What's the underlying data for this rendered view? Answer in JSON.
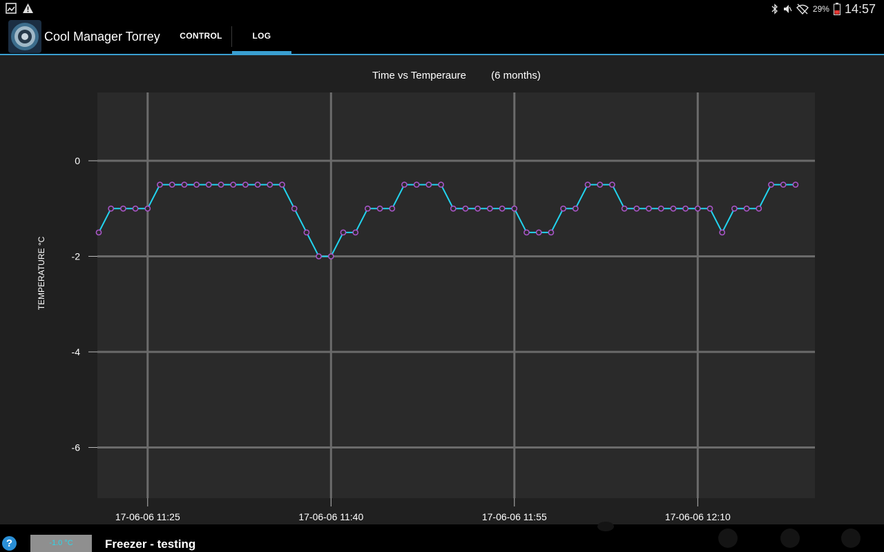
{
  "status_bar": {
    "left_icons": [
      "gallery-icon",
      "warning-icon"
    ],
    "right_icons": [
      "bluetooth-icon",
      "mute-icon",
      "wifi-off-icon",
      "battery-icon"
    ],
    "battery_percent": "29%",
    "time": "14:57"
  },
  "action_bar": {
    "app_icon": "cool-manager-logo",
    "title": "Cool Manager Torrey",
    "tabs": [
      {
        "label": "CONTROL",
        "selected": false
      },
      {
        "label": "LOG",
        "selected": true
      }
    ],
    "accent_color": "#3a9fd1"
  },
  "chart_data": {
    "type": "line",
    "title": "Time vs Temperaure",
    "subtitle": "(6 months)",
    "ylabel": "TEMPERATURE °C",
    "xlabel": "",
    "ylim": [
      -7,
      1.5
    ],
    "y_ticks": [
      {
        "value": 0,
        "label": "0"
      },
      {
        "value": -2,
        "label": "-2"
      },
      {
        "value": -4,
        "label": "-4"
      },
      {
        "value": -6,
        "label": "-6"
      }
    ],
    "x_ticks": [
      {
        "index": 4,
        "label": "17-06-06 11:25"
      },
      {
        "index": 19,
        "label": "17-06-06 11:40"
      },
      {
        "index": 34,
        "label": "17-06-06 11:55"
      },
      {
        "index": 49,
        "label": "17-06-06 12:10"
      }
    ],
    "grid": true,
    "line_color": "#22d3ee",
    "marker_color": "#a855c7",
    "series": [
      {
        "values": [
          -1.5,
          -1,
          -1,
          -1,
          -1,
          -0.5,
          -0.5,
          -0.5,
          -0.5,
          -0.5,
          -0.5,
          -0.5,
          -0.5,
          -0.5,
          -0.5,
          -0.5,
          -1,
          -1.5,
          -2,
          -2,
          -1.5,
          -1.5,
          -1,
          -1,
          -1,
          -0.5,
          -0.5,
          -0.5,
          -0.5,
          -1,
          -1,
          -1,
          -1,
          -1,
          -1,
          -1.5,
          -1.5,
          -1.5,
          -1,
          -1,
          -0.5,
          -0.5,
          -0.5,
          -1,
          -1,
          -1,
          -1,
          -1,
          -1,
          -1,
          -1,
          -1.5,
          -1,
          -1,
          -1,
          -0.5,
          -0.5,
          -0.5
        ]
      }
    ]
  },
  "bottom_bar": {
    "help_label": "?",
    "current_temp": "-1.0 °C",
    "device_name": "Freezer - testing"
  }
}
